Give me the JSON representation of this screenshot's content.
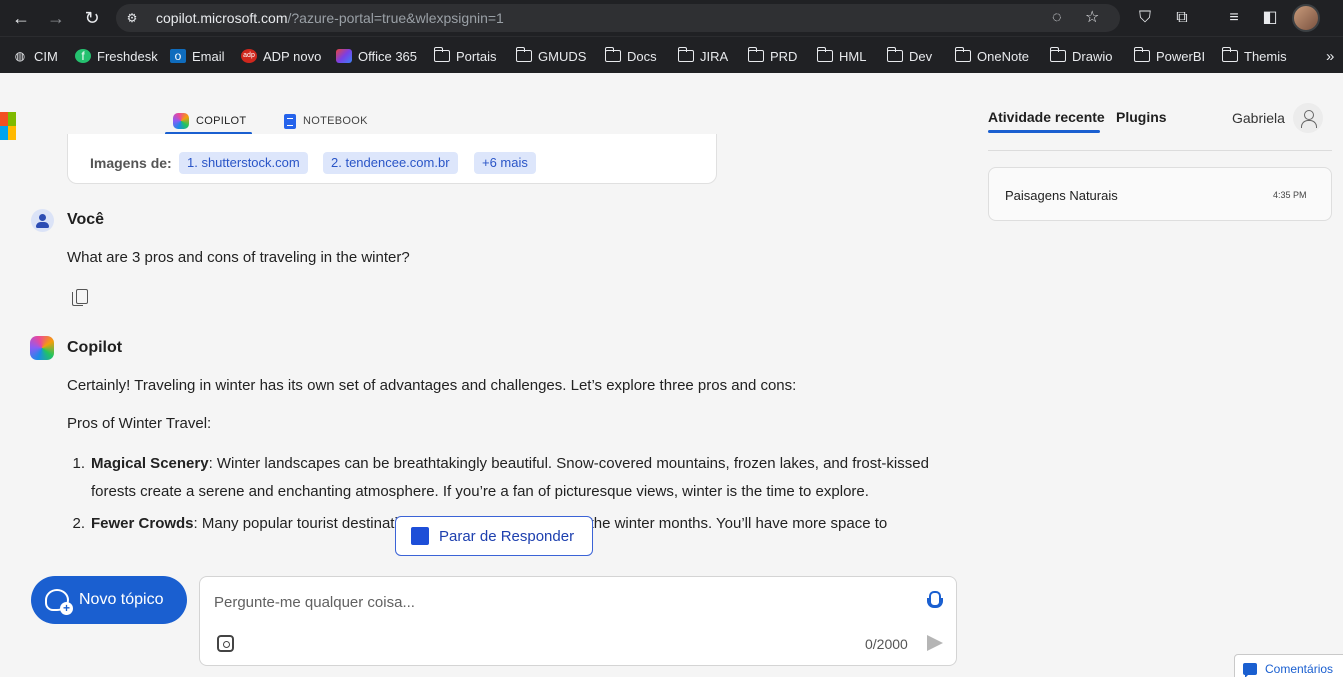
{
  "browser": {
    "url_host": "copilot.microsoft.com",
    "url_path": "/?azure-portal=true&wlexpsignin=1",
    "bookmarks": [
      {
        "label": "CIM",
        "icon": "globe-icon"
      },
      {
        "label": "Freshdesk",
        "icon": "freshdesk-icon"
      },
      {
        "label": "Email",
        "icon": "outlook-icon"
      },
      {
        "label": "ADP novo",
        "icon": "adp-icon"
      },
      {
        "label": "Office 365",
        "icon": "office-icon"
      },
      {
        "label": "Portais",
        "icon": "folder-icon"
      },
      {
        "label": "GMUDS",
        "icon": "folder-icon"
      },
      {
        "label": "Docs",
        "icon": "folder-icon"
      },
      {
        "label": "JIRA",
        "icon": "folder-icon"
      },
      {
        "label": "PRD",
        "icon": "folder-icon"
      },
      {
        "label": "HML",
        "icon": "folder-icon"
      },
      {
        "label": "Dev",
        "icon": "folder-icon"
      },
      {
        "label": "OneNote",
        "icon": "folder-icon"
      },
      {
        "label": "Drawio",
        "icon": "folder-icon"
      },
      {
        "label": "PowerBI",
        "icon": "folder-icon"
      },
      {
        "label": "Themis",
        "icon": "folder-icon"
      }
    ],
    "overflow": "»"
  },
  "tabs": {
    "copilot": "COPILOT",
    "notebook": "NOTEBOOK"
  },
  "images_card": {
    "label": "Imagens de:",
    "chips": [
      "1. shutterstock.com",
      "2. tendencee.com.br",
      "+6 mais"
    ]
  },
  "user_message": {
    "speaker": "Você",
    "text": "What are 3 pros and cons of traveling in the winter?"
  },
  "copilot_message": {
    "speaker": "Copilot",
    "intro": "Certainly! Traveling in winter has its own set of advantages and challenges. Let’s explore three pros and cons:",
    "section_title": "Pros of Winter Travel:",
    "items": [
      {
        "num": "1.",
        "title": "Magical Scenery",
        "text": ": Winter landscapes can be breathtakingly beautiful. Snow-covered mountains, frozen lakes, and frost-kissed forests create a serene and enchanting atmosphere. If you’re a fan of picturesque views, winter is the time to explore."
      },
      {
        "num": "2.",
        "title": "Fewer Crowds",
        "text": ": Many popular tourist destinations are less crowded during the winter months. You’ll have more space to"
      }
    ]
  },
  "stop_button": "Parar de Responder",
  "new_topic": "Novo tópico",
  "input": {
    "placeholder": "Pergunte-me qualquer coisa...",
    "counter": "0/2000"
  },
  "right_panel": {
    "tab_recent": "Atividade recente",
    "tab_plugins": "Plugins",
    "user_name": "Gabriela",
    "recent_items": [
      {
        "title": "Paisagens Naturais",
        "time": "4:35 PM"
      }
    ]
  },
  "feedback": "Comentários",
  "colors": {
    "accent": "#1a5fd0",
    "chrome": "#202124",
    "page_bg": "#f5f5f5"
  }
}
